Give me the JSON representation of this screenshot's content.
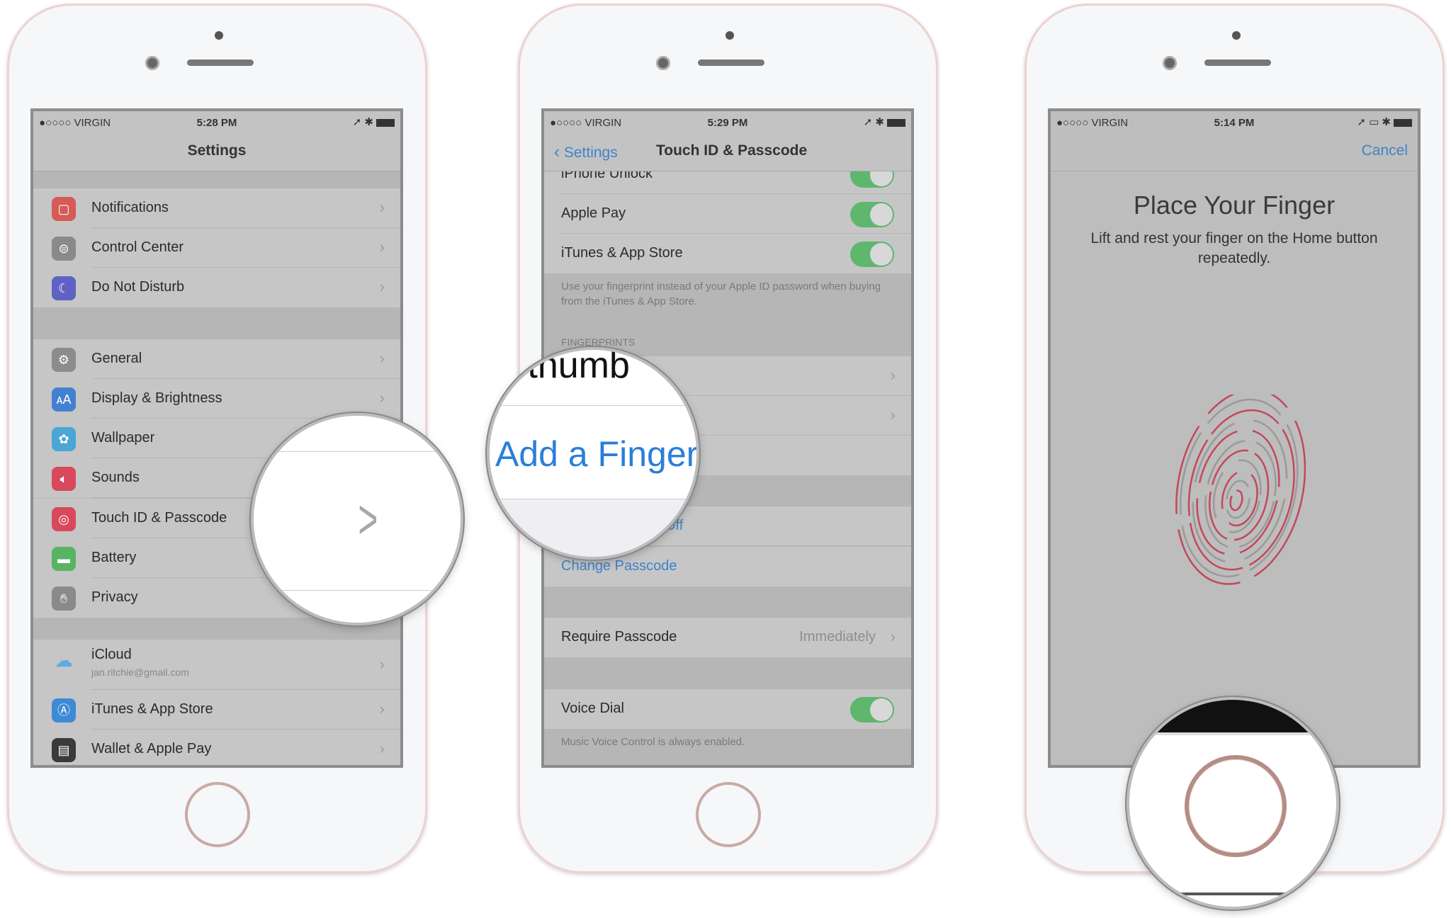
{
  "phone1": {
    "status": {
      "carrier": "●○○○○ VIRGIN",
      "time": "5:28 PM"
    },
    "title": "Settings",
    "groups": [
      [
        {
          "label": "Notifications",
          "icon": "notifications-icon",
          "color": "#d65a55"
        },
        {
          "label": "Control Center",
          "icon": "control-center-icon",
          "color": "#8a8a8a"
        },
        {
          "label": "Do Not Disturb",
          "icon": "moon-icon",
          "color": "#6061c4"
        }
      ],
      [
        {
          "label": "General",
          "icon": "gear-icon",
          "color": "#8c8c8e"
        },
        {
          "label": "Display & Brightness",
          "icon": "display-icon",
          "color": "#4381d0"
        },
        {
          "label": "Wallpaper",
          "icon": "wallpaper-icon",
          "color": "#4aa6d4"
        },
        {
          "label": "Sounds",
          "icon": "sounds-icon",
          "color": "#d9485c"
        },
        {
          "label": "Touch ID & Passcode",
          "icon": "fingerprint-icon",
          "color": "#d9485c"
        },
        {
          "label": "Battery",
          "icon": "battery-icon",
          "color": "#58b462"
        },
        {
          "label": "Privacy",
          "icon": "hand-icon",
          "color": "#8a8a8a"
        }
      ],
      [
        {
          "label": "iCloud",
          "sub": "jan.ritchie@gmail.com",
          "icon": "icloud-icon",
          "color": "#c6c6c6"
        },
        {
          "label": "iTunes & App Store",
          "icon": "app-store-icon",
          "color": "#3d8ad6"
        },
        {
          "label": "Wallet & Apple Pay",
          "icon": "wallet-icon",
          "color": "#3a3a3a"
        }
      ]
    ],
    "magnifier_icon": "chevron-right-icon"
  },
  "phone2": {
    "status": {
      "carrier": "●○○○○ VIRGIN",
      "time": "5:29 PM"
    },
    "back_label": "Settings",
    "title": "Touch ID & Passcode",
    "toggles": [
      {
        "label": "iPhone Unlock",
        "on": true
      },
      {
        "label": "Apple Pay",
        "on": true
      },
      {
        "label": "iTunes & App Store",
        "on": true
      }
    ],
    "toggles_footer": "Use your fingerprint instead of your Apple ID password when buying from the iTunes & App Store.",
    "fingerprints_header": "FINGERPRINTS",
    "passcode_off_fragment": "Off",
    "change_passcode": "Change Passcode",
    "require_passcode": {
      "label": "Require Passcode",
      "value": "Immediately"
    },
    "voice_dial": {
      "label": "Voice Dial",
      "on": true
    },
    "voice_footer": "Music Voice Control is always enabled.",
    "magnifier": {
      "top_fragment": "n thumb",
      "add_finger": "Add a Finger"
    }
  },
  "phone3": {
    "status": {
      "carrier": "●○○○○ VIRGIN",
      "time": "5:14 PM"
    },
    "cancel": "Cancel",
    "title": "Place Your Finger",
    "subtitle": "Lift and rest your finger on the Home button repeatedly.",
    "fingerprint_colors": [
      "#c2485a",
      "#9a9a9a"
    ]
  },
  "colors": {
    "accent": "#3f83c9",
    "toggle_on": "#5fb66e"
  }
}
